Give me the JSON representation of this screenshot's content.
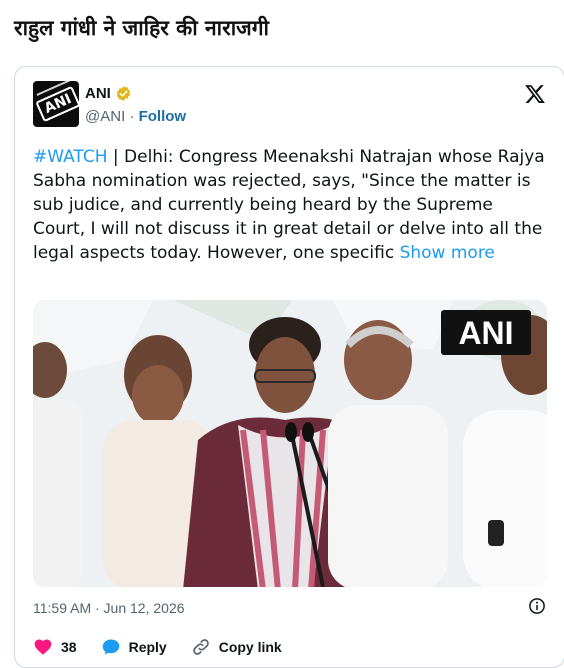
{
  "headline": "राहुल गांधी ने जाहिर की नाराजगी",
  "tweet": {
    "author": {
      "name": "ANI",
      "handle": "@ANI",
      "follow_label": "Follow",
      "avatar_text": "ANI",
      "verified": true
    },
    "text": {
      "hashtag": "#WATCH",
      "body": " | Delhi: Congress Meenakshi Natrajan whose Rajya Sabha nomination was rejected, says, \"Since the matter is sub judice, and currently being heard by the Supreme Court, I will not discuss it in great detail or delve into all the legal aspects today. However, one specific ",
      "show_more": "Show more"
    },
    "image": {
      "watermark": "ANI"
    },
    "timestamp": "11:59 AM · Jun 12, 2026",
    "actions": {
      "like_count": "38",
      "reply_label": "Reply",
      "copy_link_label": "Copy link"
    }
  },
  "icons": {
    "verified": "verified-badge-icon",
    "x_logo": "x-logo-icon",
    "info": "info-icon",
    "like": "heart-icon",
    "reply": "speech-bubble-icon",
    "copy": "link-icon"
  },
  "colors": {
    "link": "#1d9bf0",
    "follow": "#1d6fa5",
    "like": "#f91880",
    "reply": "#1d9bf0",
    "verified": "#e2b719",
    "muted": "#536471",
    "text": "#0f1419"
  }
}
